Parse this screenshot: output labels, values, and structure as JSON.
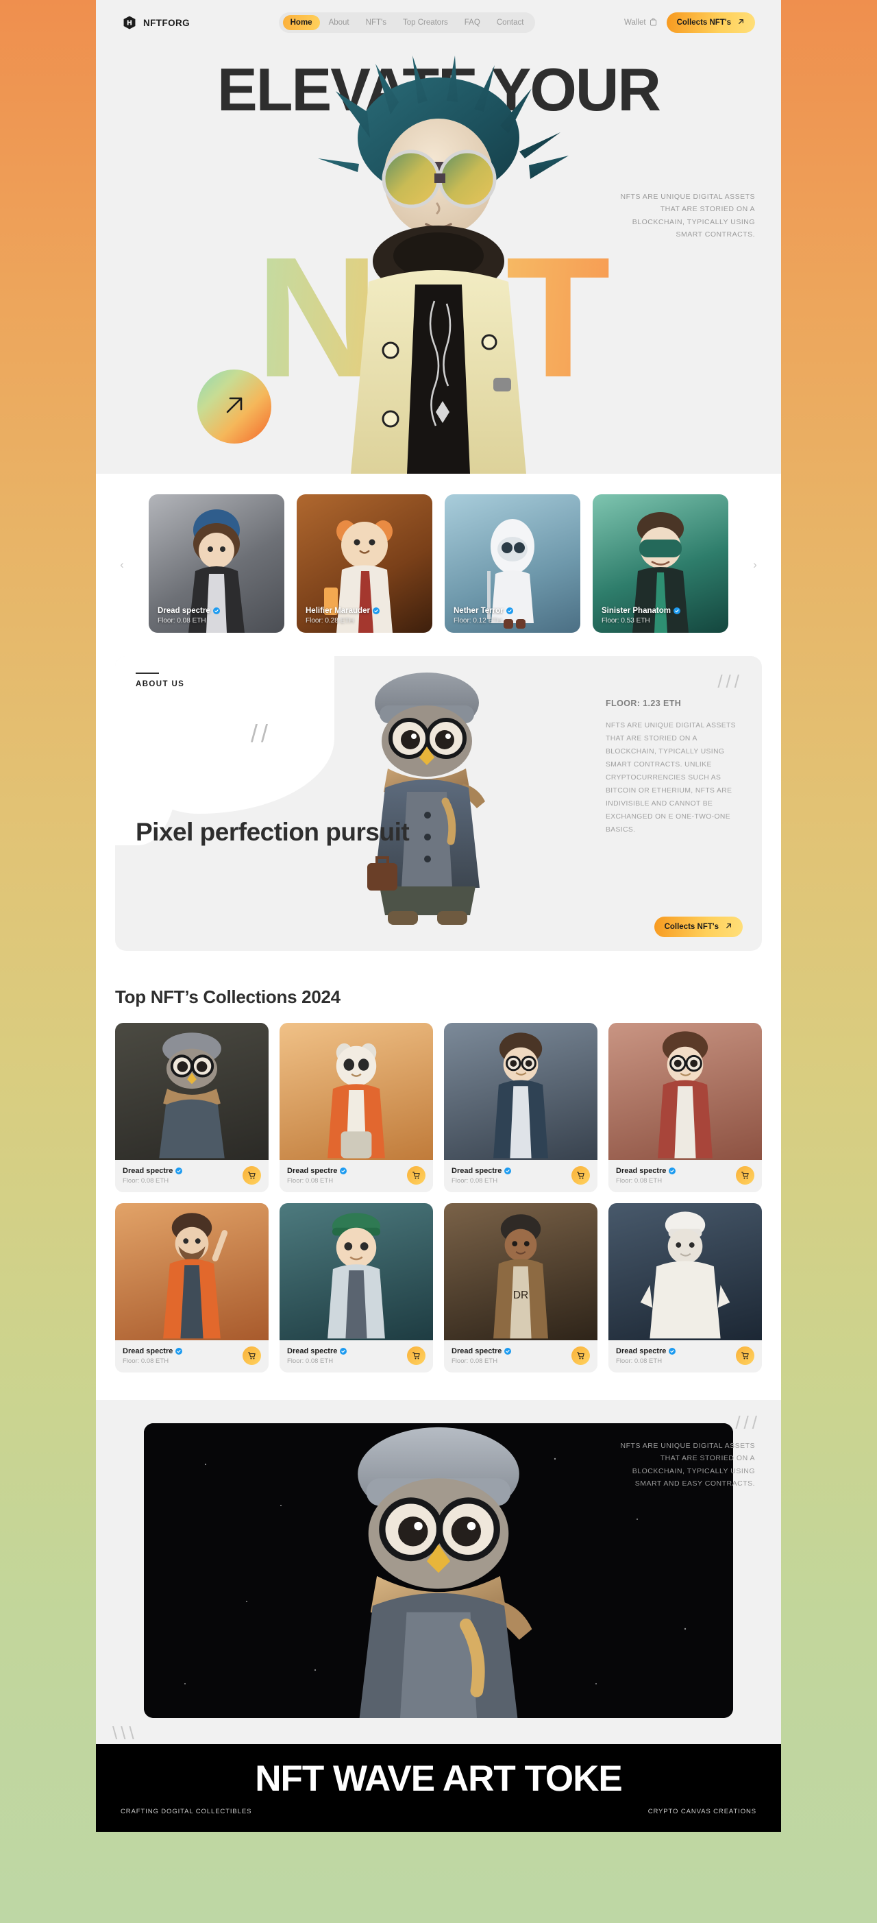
{
  "nav": {
    "brand": "NFTFORG",
    "logo_icon": "cube-logo-icon",
    "links": [
      {
        "label": "Home",
        "active": true
      },
      {
        "label": "About",
        "active": false
      },
      {
        "label": "NFT's",
        "active": false
      },
      {
        "label": "Top Creators",
        "active": false
      },
      {
        "label": "FAQ",
        "active": false
      },
      {
        "label": "Contact",
        "active": false
      }
    ],
    "wallet_label": "Wallet",
    "wallet_icon": "wallet-icon",
    "cta_label": "Collects NFT's",
    "cta_icon": "arrow-up-right-icon"
  },
  "hero": {
    "title": "ELEVATE YOUR",
    "word": "NFT",
    "paragraph": "NFTS ARE UNIQUE DIGITAL ASSETS THAT ARE STORIED ON A BLOCKCHAIN, TYPICALLY USING SMART CONTRACTS.",
    "badge_icon": "arrow-up-right-icon"
  },
  "carousel": {
    "prev_icon": "chevron-left-icon",
    "next_icon": "chevron-right-icon",
    "cards": [
      {
        "name": "Dread spectre",
        "floor": "Floor: 0.08 ETH",
        "bg": "#8d9096"
      },
      {
        "name": "Helifier Marauder",
        "floor": "Floor: 0.28 ETH",
        "bg": "#6b3d1d"
      },
      {
        "name": "Nether Terror",
        "floor": "Floor: 0.12 ETH",
        "bg": "#6f93a6"
      },
      {
        "name": "Sinister Phanatom",
        "floor": "Floor: 0.53 ETH",
        "bg": "#2e6b5e"
      }
    ]
  },
  "about": {
    "eyebrow": "ABOUT US",
    "heading": "Pixel perfection pursuit",
    "floor": "FLOOR: 1.23 ETH",
    "paragraph": "NFTS ARE UNIQUE DIGITAL ASSETS THAT ARE STORIED ON A BLOCKCHAIN, TYPICALLY USING SMART CONTRACTS. UNLIKE CRYPTOCURRENCIES SUCH AS BITCOIN OR ETHERIUM, NFTS ARE INDIVISIBLE AND CANNOT BE EXCHANGED ON E ONE-TWO-ONE BASICS.",
    "cta_label": "Collects NFT's",
    "cta_icon": "arrow-up-right-icon",
    "slash_mark": "//",
    "slash_mark_corner": "///"
  },
  "collections": {
    "heading": "Top NFT’s Collections 2024",
    "cart_icon": "shopping-cart-icon",
    "verified_icon": "verified-badge-icon",
    "items": [
      {
        "name": "Dread spectre",
        "floor": "Floor: 0.08 ETH",
        "bg": "#3c3a33"
      },
      {
        "name": "Dread spectre",
        "floor": "Floor: 0.08 ETH",
        "bg": "#d79a5a"
      },
      {
        "name": "Dread spectre",
        "floor": "Floor: 0.08 ETH",
        "bg": "#4a5560"
      },
      {
        "name": "Dread spectre",
        "floor": "Floor: 0.08 ETH",
        "bg": "#a56a5a"
      },
      {
        "name": "Dread spectre",
        "floor": "Floor: 0.08 ETH",
        "bg": "#c4703c"
      },
      {
        "name": "Dread spectre",
        "floor": "Floor: 0.08 ETH",
        "bg": "#2f4a52"
      },
      {
        "name": "Dread spectre",
        "floor": "Floor: 0.08 ETH",
        "bg": "#5a4636"
      },
      {
        "name": "Dread spectre",
        "floor": "Floor: 0.08 ETH",
        "bg": "#2b3b4e"
      }
    ]
  },
  "showcase": {
    "paragraph": "NFTS ARE UNIQUE DIGITAL ASSETS THAT ARE STORIED ON A BLOCKCHAIN, TYPICALLY USING SMART AND EASY CONTRACTS.",
    "slash_corner": "///",
    "slash_left": "\\\\\\"
  },
  "footer": {
    "heading": "NFT WAVE ART TOKE",
    "left": "CRAFTING DOGITAL COLLECTIBLES",
    "right": "CRYPTO CANVAS CREATIONS"
  },
  "colors": {
    "accent_orange": "#f7991f",
    "accent_yellow": "#ffd05a",
    "bg_frame": "#f1f1f1",
    "text_dark": "#2e2e2e",
    "text_muted": "#9b9b9b",
    "verified_blue": "#1d9bf0"
  }
}
